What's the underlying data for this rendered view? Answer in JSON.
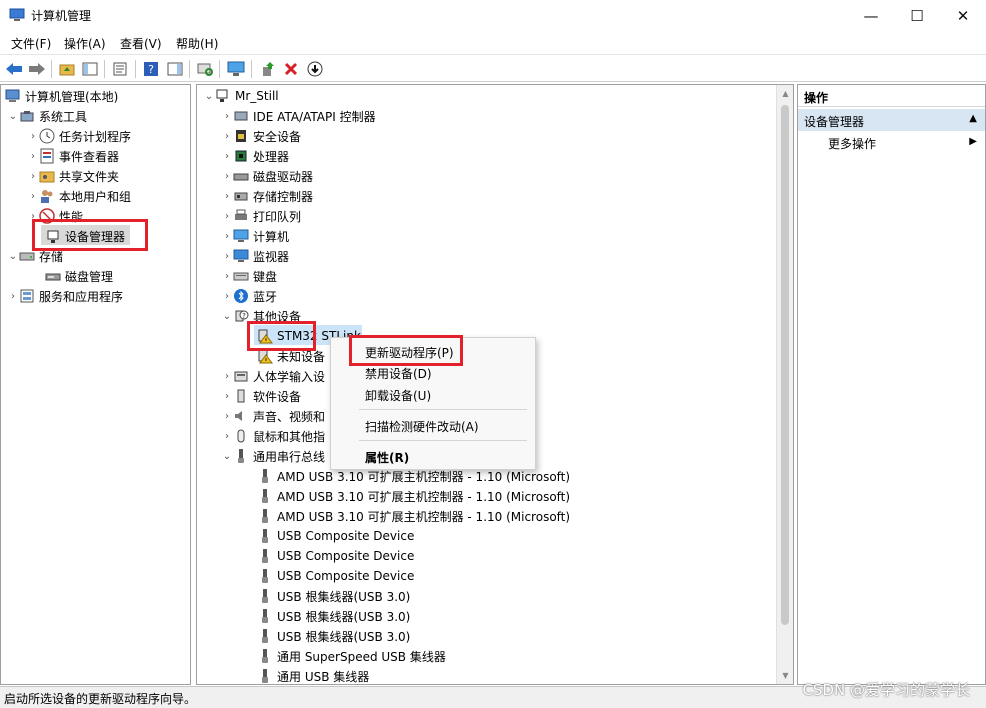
{
  "window": {
    "title": "计算机管理",
    "minimize": "—",
    "maximize": "☐",
    "close": "✕"
  },
  "menu": [
    "文件(F)",
    "操作(A)",
    "查看(V)",
    "帮助(H)"
  ],
  "left_tree": {
    "root": "计算机管理(本地)",
    "system_tools": "系统工具",
    "task_scheduler": "任务计划程序",
    "event_viewer": "事件查看器",
    "shared_folders": "共享文件夹",
    "local_users": "本地用户和组",
    "performance": "性能",
    "device_manager": "设备管理器",
    "storage": "存储",
    "disk_management": "磁盘管理",
    "services_apps": "服务和应用程序"
  },
  "device_tree": {
    "computer_name": "Mr_Still",
    "categories": [
      "IDE ATA/ATAPI 控制器",
      "安全设备",
      "处理器",
      "磁盘驱动器",
      "存储控制器",
      "打印队列",
      "计算机",
      "监视器",
      "键盘",
      "蓝牙"
    ],
    "other_devices": "其他设备",
    "stm32": "STM32 STLink",
    "unknown": "未知设备",
    "after_categories": [
      "人体学输入设",
      "软件设备",
      "声音、视频和",
      "鼠标和其他指"
    ],
    "usb_controllers": "通用串行总线",
    "usb_devices": [
      "AMD USB 3.10 可扩展主机控制器 - 1.10 (Microsoft)",
      "AMD USB 3.10 可扩展主机控制器 - 1.10 (Microsoft)",
      "AMD USB 3.10 可扩展主机控制器 - 1.10 (Microsoft)",
      "USB Composite Device",
      "USB Composite Device",
      "USB Composite Device",
      "USB 根集线器(USB 3.0)",
      "USB 根集线器(USB 3.0)",
      "USB 根集线器(USB 3.0)",
      "通用 SuperSpeed USB 集线器",
      "通用 USB 集线器"
    ]
  },
  "context_menu": {
    "update": "更新驱动程序(P)",
    "disable": "禁用设备(D)",
    "uninstall": "卸载设备(U)",
    "scan": "扫描检测硬件改动(A)",
    "properties": "属性(R)"
  },
  "actions": {
    "header": "操作",
    "section": "设备管理器",
    "more": "更多操作"
  },
  "status": "启动所选设备的更新驱动程序向导。",
  "watermark": "CSDN @爱学习的蒙学长",
  "colors": {
    "highlight": "#e2212a",
    "selection": "#cce4f7",
    "actions_section": "#d8e6f3"
  }
}
